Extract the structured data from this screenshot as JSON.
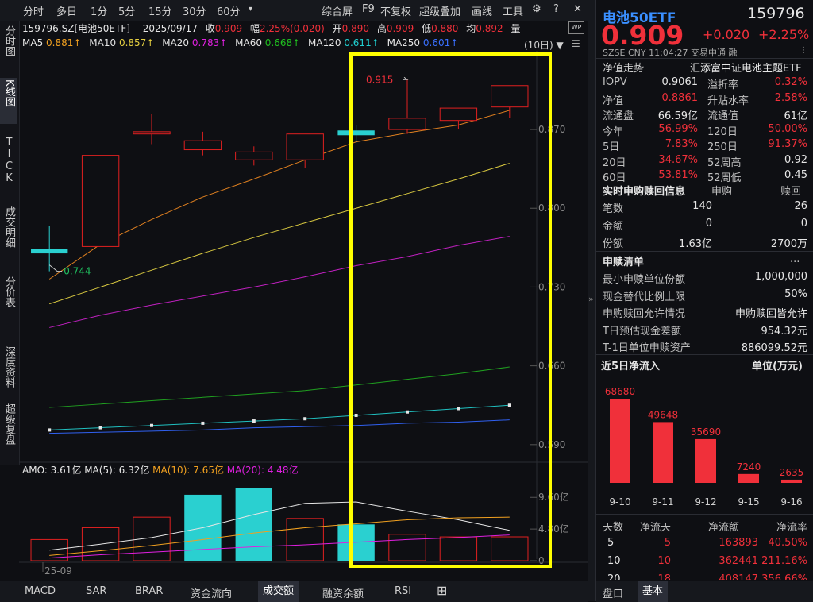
{
  "toolbar": {
    "left_items": [
      "分时",
      "多日",
      "1分",
      "5分",
      "15分",
      "30分",
      "60分"
    ],
    "right_items": [
      "综合屏",
      "F9",
      "不复权",
      "超级叠加",
      "画线",
      "工具"
    ]
  },
  "leftnav": [
    "分时图",
    "K线图",
    "TICK",
    "成交明细",
    "分价表",
    "深度资料",
    "超级复盘"
  ],
  "info": {
    "code": "159796.SZ[电池50ETF]",
    "date": "2025/09/17",
    "close_label": "收",
    "close": "0.909",
    "chg_label": "幅",
    "chg": "2.25%(0.020)",
    "open_label": "开",
    "open": "0.890",
    "high_label": "高",
    "high": "0.909",
    "low_label": "低",
    "low": "0.880",
    "avg_label": "均",
    "avg": "0.892",
    "vol_label": "量",
    "period": "(10日)"
  },
  "ma": {
    "ma5": "MA5",
    "ma5v": "0.881↑",
    "ma10": "MA10",
    "ma10v": "0.857↑",
    "ma20": "MA20",
    "ma20v": "0.783↑",
    "ma60": "MA60",
    "ma60v": "0.668↑",
    "ma120": "MA120",
    "ma120v": "0.611↑",
    "ma250": "MA250",
    "ma250v": "0.601↑"
  },
  "colors": {
    "ma5": "#e8e8e8",
    "ma10": "#f0a020",
    "ma20": "#e020e0",
    "ma60": "#20c020",
    "ma120": "#20d0d0",
    "ma250": "#3060f0",
    "up": "#e02020",
    "down": "#2ad0d0"
  },
  "chart_data": {
    "type": "candlestick",
    "ylim": [
      0.58,
      0.93
    ],
    "y_ticks": [
      "0.870",
      "0.800",
      "0.730",
      "0.660",
      "0.590"
    ],
    "candles": [
      {
        "o": 0.762,
        "h": 0.784,
        "l": 0.744,
        "c": 0.762,
        "dir": "down"
      },
      {
        "o": 0.766,
        "h": 0.847,
        "l": 0.766,
        "c": 0.847,
        "dir": "up"
      },
      {
        "o": 0.868,
        "h": 0.884,
        "l": 0.857,
        "c": 0.866,
        "dir": "up"
      },
      {
        "o": 0.852,
        "h": 0.868,
        "l": 0.847,
        "c": 0.86,
        "dir": "up"
      },
      {
        "o": 0.843,
        "h": 0.855,
        "l": 0.838,
        "c": 0.85,
        "dir": "up"
      },
      {
        "o": 0.843,
        "h": 0.866,
        "l": 0.836,
        "c": 0.866,
        "dir": "up"
      },
      {
        "o": 0.867,
        "h": 0.874,
        "l": 0.858,
        "c": 0.864,
        "dir": "down"
      },
      {
        "o": 0.87,
        "h": 0.915,
        "l": 0.866,
        "c": 0.88,
        "dir": "up"
      },
      {
        "o": 0.878,
        "h": 0.889,
        "l": 0.87,
        "c": 0.889,
        "dir": "up"
      },
      {
        "o": 0.89,
        "h": 0.909,
        "l": 0.88,
        "c": 0.909,
        "dir": "up"
      }
    ],
    "ma10_line": [
      0.737,
      0.768,
      0.79,
      0.81,
      0.826,
      0.843,
      0.859,
      0.867,
      0.874,
      0.887
    ],
    "ma20_line": [
      0.715,
      0.73,
      0.745,
      0.76,
      0.774,
      0.787,
      0.8,
      0.813,
      0.826,
      0.84
    ],
    "ma60_line": [
      0.694,
      0.705,
      0.714,
      0.722,
      0.73,
      0.739,
      0.749,
      0.757,
      0.767,
      0.775
    ],
    "ma120_line": [
      0.623,
      0.626,
      0.629,
      0.632,
      0.635,
      0.638,
      0.643,
      0.648,
      0.653,
      0.659
    ],
    "ma250_line": [
      0.603,
      0.605,
      0.607,
      0.609,
      0.611,
      0.613,
      0.616,
      0.619,
      0.622,
      0.625
    ],
    "ma250b_line": [
      0.6,
      0.601,
      0.602,
      0.603,
      0.605,
      0.606,
      0.607,
      0.609,
      0.61,
      0.612
    ],
    "annotations": {
      "high": "0.915",
      "low": "0.744"
    },
    "x_label": "25-09",
    "amo": {
      "title": "AMO:",
      "amo_value": "3.61亿",
      "ma5_label": "MA(5):",
      "ma5_value": "6.32亿",
      "ma10_label": "MA(10):",
      "ma10_value": "7.65亿",
      "ma20_label": "MA(20):",
      "ma20_value": "4.48亿",
      "ylim": [
        0,
        13
      ],
      "y_ticks": [
        "9.60亿",
        "4.80亿",
        "0"
      ],
      "bars": [
        3.2,
        5.0,
        6.6,
        10.0,
        11.0,
        6.4,
        5.5,
        4.0,
        3.6,
        3.61
      ],
      "bar_dirs": [
        "up",
        "up",
        "up",
        "down",
        "down",
        "up",
        "down",
        "up",
        "up",
        "up"
      ],
      "ma5_line": [
        1.6,
        2.5,
        3.5,
        5.0,
        7.0,
        8.7,
        8.9,
        7.5,
        6.2,
        4.6
      ],
      "ma10_line": [
        0.8,
        1.5,
        2.3,
        3.2,
        4.2,
        5.0,
        5.6,
        6.2,
        6.5,
        6.6
      ],
      "ma20_line": [
        0.4,
        0.9,
        1.3,
        1.7,
        2.1,
        2.4,
        2.8,
        3.2,
        3.5,
        3.9
      ]
    }
  },
  "bottom_tabs": [
    "MACD",
    "SAR",
    "BRAR",
    "资金流向",
    "成交额",
    "融资余额",
    "RSI",
    "⊞"
  ],
  "right": {
    "name": "电池50ETF",
    "code": "159796",
    "price": "0.909",
    "change": "+0.020",
    "pct": "+2.25%",
    "exchange": "SZSE",
    "currency": "CNY",
    "time": "11:04:27",
    "via": "交易中通",
    "rong": "融",
    "trend_label": "净值走势",
    "fund_name": "汇添富中证电池主题ETF",
    "rows": [
      [
        "IOPV",
        "0.9061",
        "溢折率",
        "0.32%"
      ],
      [
        "净值",
        "0.8861",
        "升贴水率",
        "2.58%"
      ],
      [
        "流通盘",
        "66.59亿",
        "流通值",
        "61亿"
      ],
      [
        "今年",
        "56.99%",
        "120日",
        "50.00%"
      ],
      [
        "5日",
        "7.83%",
        "250日",
        "91.37%"
      ],
      [
        "20日",
        "34.67%",
        "52周高",
        "0.92"
      ],
      [
        "60日",
        "53.81%",
        "52周低",
        "0.45"
      ]
    ],
    "sub_title": "实时申购赎回信息",
    "sub_col1": "申购",
    "sub_col2": "赎回",
    "sub_rows": [
      [
        "笔数",
        "140",
        "26"
      ],
      [
        "金额",
        "0",
        "0"
      ],
      [
        "份额",
        "1.63亿",
        "2700万"
      ]
    ],
    "list_title": "申赎清单",
    "list_more": "...",
    "list_rows": [
      [
        "最小申赎单位份额",
        "1,000,000"
      ],
      [
        "现金替代比例上限",
        "50%"
      ],
      [
        "申购赎回允许情况",
        "申购赎回皆允许"
      ],
      [
        "T日预估现金差额",
        "954.32元"
      ],
      [
        "T-1日单位申赎资产",
        "886099.52元"
      ]
    ],
    "flow_title": "近5日净流入",
    "flow_unit": "单位(万元)",
    "flow_chart": {
      "type": "bar",
      "categories": [
        "9-10",
        "9-11",
        "9-12",
        "9-15",
        "9-16"
      ],
      "values": [
        68680,
        49648,
        35690,
        7240,
        2635
      ],
      "ylim": [
        0,
        70000
      ]
    },
    "table_headers": [
      "天数",
      "净流天",
      "净流额",
      "净流率"
    ],
    "table_rows": [
      [
        "5",
        "5",
        "163893",
        "40.50%"
      ],
      [
        "10",
        "10",
        "362441",
        "211.16%"
      ],
      [
        "20",
        "18",
        "408147",
        "356.66%"
      ]
    ],
    "bottom_tabs": [
      "盘口",
      "基本"
    ]
  }
}
